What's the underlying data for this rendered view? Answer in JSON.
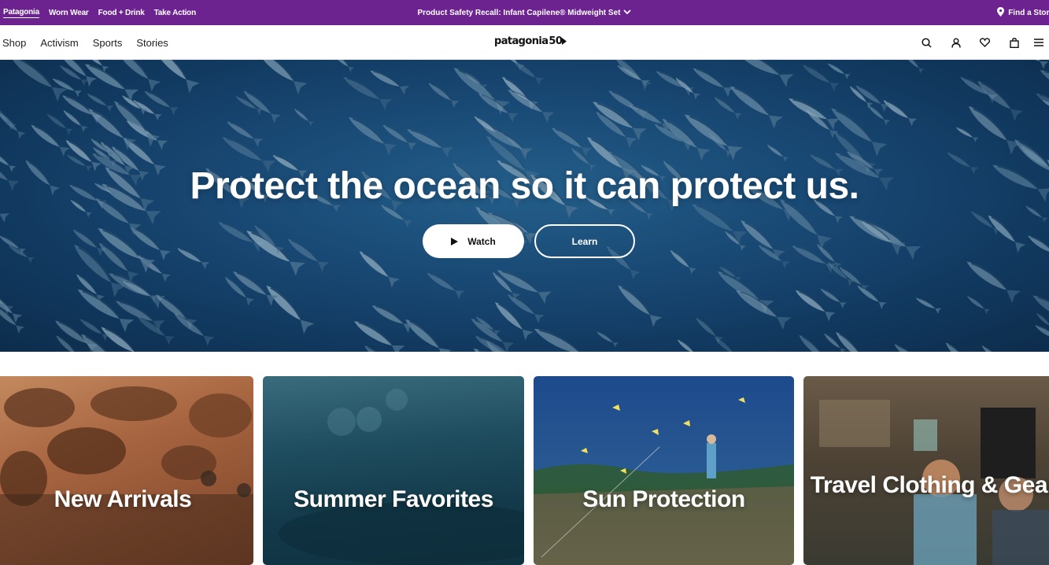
{
  "utility_bar": {
    "links": [
      "Patagonia",
      "Worn Wear",
      "Food + Drink",
      "Take Action"
    ],
    "recall_text": "Product Safety Recall: Infant Capilene® Midweight Set",
    "find_store": "Find a Store"
  },
  "nav": {
    "links": [
      "Shop",
      "Activism",
      "Sports",
      "Stories"
    ],
    "logo_text": "patagonia",
    "logo_badge": "50"
  },
  "hero": {
    "title": "Protect the ocean so it can protect us.",
    "watch_label": "Watch",
    "learn_label": "Learn"
  },
  "cards": [
    {
      "label": "New Arrivals"
    },
    {
      "label": "Summer Favorites"
    },
    {
      "label": "Sun Protection"
    },
    {
      "label": "Travel Clothing & Gear"
    }
  ],
  "colors": {
    "utility_bg": "#6c2390",
    "hero_blue": "#1c4f7d"
  },
  "icons": [
    "map-pin-icon",
    "chevron-down-icon",
    "search-icon",
    "account-icon",
    "heart-icon",
    "bag-icon",
    "menu-icon",
    "play-icon"
  ]
}
